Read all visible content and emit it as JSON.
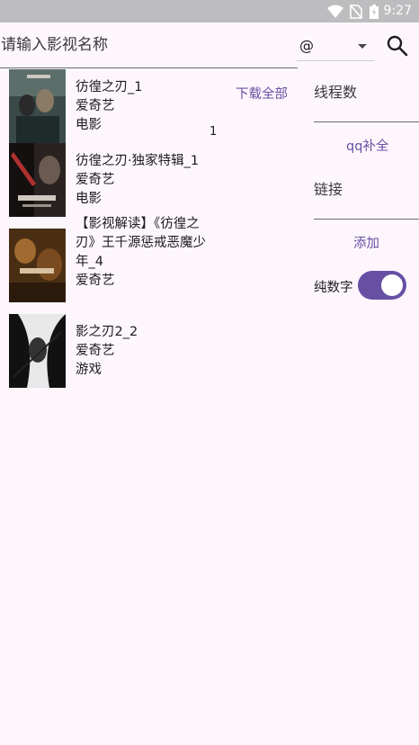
{
  "status_bar": {
    "time": "9:27",
    "icons": [
      "wifi-icon",
      "no-sim-icon",
      "battery-icon"
    ]
  },
  "search": {
    "placeholder": "请输入影视名称",
    "value": "",
    "select_value": "@",
    "search_icon": "search-icon"
  },
  "results": [
    {
      "title": "彷徨之刃_1",
      "source": "爱奇艺",
      "type": "电影"
    },
    {
      "title": "彷徨之刃·独家特辑_1",
      "source": "爱奇艺",
      "type": "电影"
    },
    {
      "title": "【影视解读】《彷徨之刃》王千源惩戒恶魔少年_4",
      "source": "爱奇艺",
      "type": ""
    },
    {
      "title": "影之刃2_2",
      "source": "爱奇艺",
      "type": "游戏"
    }
  ],
  "download_all_label": "下载全部",
  "count": "1",
  "side_panel": {
    "thread_placeholder": "线程数",
    "qq_complete_label": "qq补全",
    "link_placeholder": "链接",
    "add_label": "添加",
    "pure_number_label": "纯数字",
    "pure_number_on": true
  },
  "colors": {
    "accent": "#6750a4",
    "background": "#fdf7fd",
    "status_bar": "#bdbcbf"
  }
}
